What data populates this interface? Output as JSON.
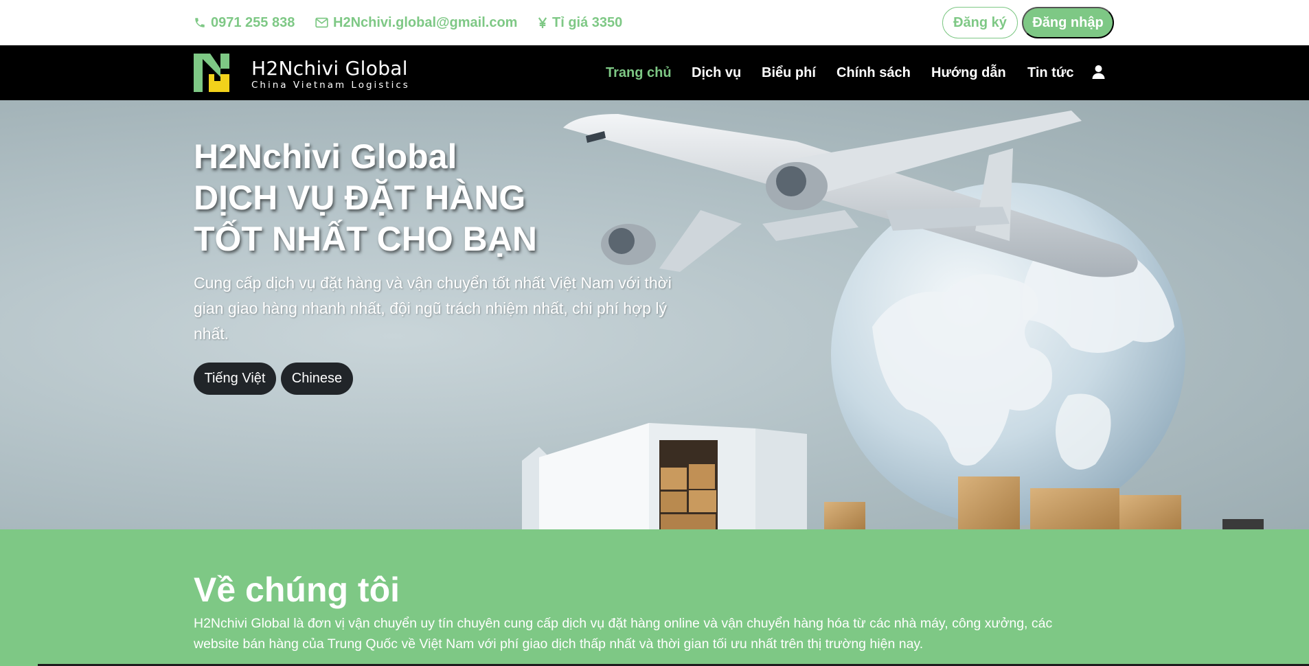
{
  "topbar": {
    "phone": "0971 255 838",
    "email": "H2Nchivi.global@gmail.com",
    "exchange_rate": "Tỉ giá 3350",
    "register_label": "Đăng ký",
    "login_label": "Đăng nhập"
  },
  "navbar": {
    "logo_title": "H2Nchivi Global",
    "logo_subtitle": "China Vietnam Logistics",
    "items": [
      {
        "label": "Trang chủ",
        "active": true
      },
      {
        "label": "Dịch vụ",
        "active": false
      },
      {
        "label": "Biểu phí",
        "active": false
      },
      {
        "label": "Chính sách",
        "active": false
      },
      {
        "label": "Hướng dẫn",
        "active": false
      },
      {
        "label": "Tin tức",
        "active": false
      }
    ]
  },
  "hero": {
    "title_line1": "H2Nchivi Global",
    "title_line2": "DỊCH VỤ ĐẶT HÀNG",
    "title_line3": "TỐT NHẤT CHO BẠN",
    "description": "Cung cấp dịch vụ đặt hàng và vận chuyển tốt nhất Việt Nam với thời gian giao hàng nhanh nhất, đội ngũ trách nhiệm nhất, chi phí hợp lý nhất.",
    "languages": [
      "Tiếng Việt",
      "Chinese"
    ]
  },
  "about": {
    "title": "Về chúng tôi",
    "text": "H2Nchivi Global là đơn vị vận chuyển uy tín chuyên cung cấp dịch vụ đặt hàng online và vận chuyển hàng hóa từ các nhà máy, công xưởng, các website bán hàng của Trung Quốc về Việt Nam với phí giao dịch thấp nhất và thời gian tối ưu nhất trên thị trường hiện nay."
  },
  "colors": {
    "accent": "#7ec885",
    "nav_bg": "#000000",
    "logo_yellow": "#f2d21b",
    "button_dark": "#212529"
  },
  "icons": {
    "phone": "phone-icon",
    "email": "envelope-icon",
    "currency": "yen-icon",
    "user": "user-icon"
  }
}
